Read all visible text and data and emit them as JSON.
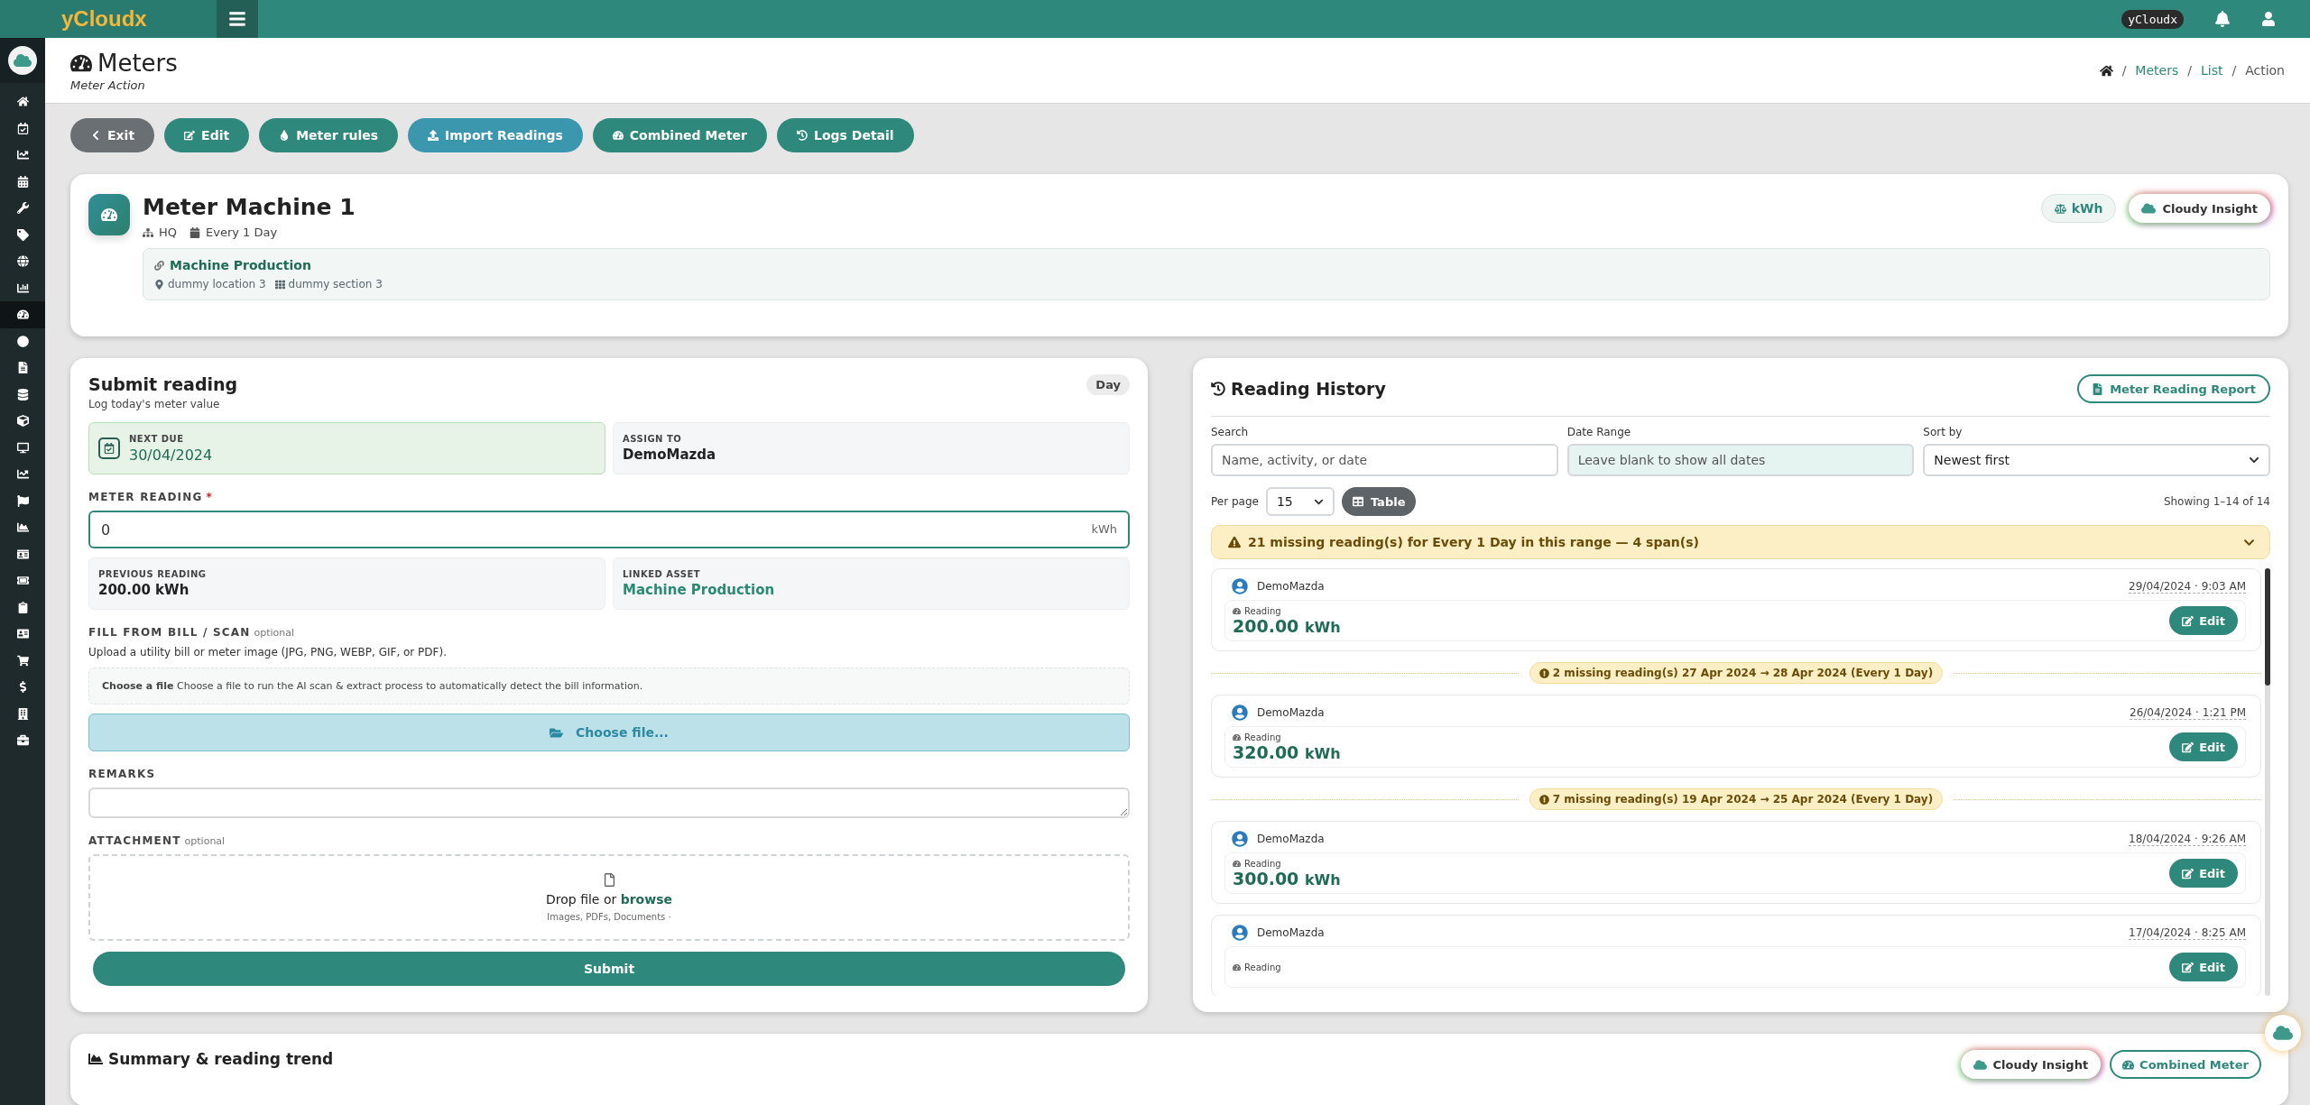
{
  "topbar": {
    "logo": "yCloudx",
    "badge": "yCloudx"
  },
  "sidebar": {
    "items": [
      {
        "selected": false
      },
      {
        "selected": false
      },
      {
        "selected": false
      },
      {
        "selected": false
      },
      {
        "selected": false
      },
      {
        "selected": false
      },
      {
        "selected": false
      },
      {
        "selected": false
      },
      {
        "selected": true
      },
      {
        "selected": false
      },
      {
        "selected": false
      },
      {
        "selected": false
      },
      {
        "selected": false
      },
      {
        "selected": false
      },
      {
        "selected": false
      },
      {
        "selected": false
      },
      {
        "selected": false
      },
      {
        "selected": false
      },
      {
        "selected": false
      },
      {
        "selected": false
      },
      {
        "selected": false
      },
      {
        "selected": false
      },
      {
        "selected": false
      },
      {
        "selected": false
      },
      {
        "selected": false
      }
    ]
  },
  "page_header": {
    "title": "Meters",
    "subtitle": "Meter Action",
    "breadcrumb": [
      "Meters",
      "List",
      "Action"
    ],
    "separator": "/"
  },
  "actions": [
    {
      "label": "Exit",
      "kind": "back"
    },
    {
      "label": "Edit",
      "kind": "primary"
    },
    {
      "label": "Meter rules",
      "kind": "primary"
    },
    {
      "label": "Import Readings",
      "kind": "info"
    },
    {
      "label": "Combined Meter",
      "kind": "primary"
    },
    {
      "label": "Logs Detail",
      "kind": "primary"
    }
  ],
  "meter": {
    "name": "Meter Machine 1",
    "site": "HQ",
    "frequency": "Every 1 Day",
    "unit": "kWh",
    "insight_button": "Cloudy Insight",
    "asset": {
      "name": "Machine Production",
      "location": "dummy location 3",
      "section": "dummy section 3"
    }
  },
  "submit": {
    "title": "Submit reading",
    "subtitle": "Log today's meter value",
    "period": "Day",
    "next_due_label": "NEXT DUE",
    "next_due": "30/04/2024",
    "assign_label": "ASSIGN TO",
    "assign_to": "DemoMazda",
    "reading_label": "METER READING",
    "required_mark": "*",
    "reading_value": "0",
    "reading_unit": "kWh",
    "previous_label": "PREVIOUS READING",
    "previous_value": "200.00 kWh",
    "linked_label": "LINKED ASSET",
    "linked_value": "Machine Production",
    "bill_label": "FILL FROM BILL / SCAN",
    "bill_optional": "optional",
    "bill_hint": "Upload a utility bill or meter image (JPG, PNG, WEBP, GIF, or PDF).",
    "scan_note": "**Choose a file** Choose a file to run the AI scan & extract process to automatically detect the bill information.",
    "choose_button": "Choose file...",
    "remarks_label": "REMARKS",
    "attachment_label": "ATTACHMENT",
    "attachment_optional": "optional",
    "drop_text": "Drop file or",
    "browse_link": "browse",
    "drop_hint": "Images, PDFs, Documents ·",
    "submit_button": "Submit"
  },
  "history": {
    "title": "Reading History",
    "report_button": "Meter Reading Report",
    "search_label": "Search",
    "search_placeholder": "Name, activity, or date",
    "date_label": "Date Range",
    "date_placeholder": "Leave blank to show all dates",
    "sort_label": "Sort by",
    "sort_value": "Newest first",
    "per_page_label": "Per page",
    "per_page": "15",
    "view_button": "Table",
    "showing": "Showing 1–14 of 14",
    "alert": {
      "text": "21 missing reading(s) for Every 1 Day in this range — 4 span(s)",
      "expanded": false
    },
    "entries": [
      {
        "kind": "reading",
        "user": "DemoMazda",
        "time": "29/04/2024 · 9:03 AM",
        "label": "Reading",
        "value": "200.00",
        "unit": "kWh",
        "edit": "Edit"
      },
      {
        "kind": "gap",
        "text": "2 missing reading(s) 27 Apr 2024 → 28 Apr 2024 (Every 1 Day)"
      },
      {
        "kind": "reading",
        "user": "DemoMazda",
        "time": "26/04/2024 · 1:21 PM",
        "label": "Reading",
        "value": "320.00",
        "unit": "kWh",
        "edit": "Edit"
      },
      {
        "kind": "gap",
        "text": "7 missing reading(s) 19 Apr 2024 → 25 Apr 2024 (Every 1 Day)"
      },
      {
        "kind": "reading",
        "user": "DemoMazda",
        "time": "18/04/2024 · 9:26 AM",
        "label": "Reading",
        "value": "300.00",
        "unit": "kWh",
        "edit": "Edit"
      },
      {
        "kind": "reading",
        "user": "DemoMazda",
        "time": "17/04/2024 · 8:25 AM",
        "label": "Reading",
        "edit": "Edit"
      }
    ]
  },
  "summary": {
    "title": "Summary & reading trend",
    "insight_button": "Cloudy Insight",
    "combined_button": "Combined Meter"
  }
}
